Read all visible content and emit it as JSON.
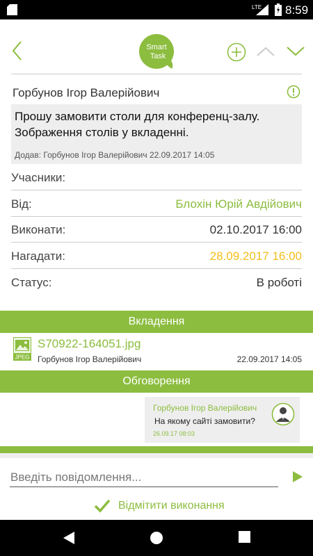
{
  "status_bar": {
    "network": "LTE",
    "time": "8:59"
  },
  "header": {
    "logo_line1": "Smart",
    "logo_line2": "Task"
  },
  "task": {
    "author": "Горбунов Ігор Валерійович",
    "message": "Прошу замовити столи для конференц-залу. Зображення столів у вкладенні.",
    "added_by_label": "Додав:",
    "added_by_name": "Горбунов Ігор Валерійович",
    "added_at": "22.09.2017 14:05"
  },
  "fields": {
    "participants_label": "Учасники:",
    "participants_value": "",
    "from_label": "Від:",
    "from_value": "Блохін Юрій Авдійович",
    "due_label": "Виконати:",
    "due_value": "02.10.2017 16:00",
    "remind_label": "Нагадати:",
    "remind_value": "28.09.2017 16:00",
    "status_label": "Статус:",
    "status_value": "В роботі"
  },
  "attachments": {
    "title": "Вкладення",
    "items": [
      {
        "file_type": "JPEG",
        "filename": "S70922-164051.jpg",
        "uploader": "Горбунов Ігор Валерійович",
        "date": "22.09.2017 14:05"
      }
    ]
  },
  "discussion": {
    "title": "Обговорення",
    "comments": [
      {
        "author": "Горбунов Ігор Валерійович",
        "text": "На якому сайті замовити?",
        "time": "26.09.17 08:03"
      }
    ]
  },
  "composer": {
    "placeholder": "Введіть повідомлення...",
    "value": ""
  },
  "complete_action": {
    "label": "Відмітити виконання"
  },
  "colors": {
    "accent": "#8cbd3f",
    "reminder": "#f2be1a",
    "panel": "#eeeeee"
  },
  "icons": {
    "back": "chevron-left-icon",
    "add": "plus-circle-icon",
    "prev": "chevron-up-icon",
    "next": "chevron-down-icon",
    "alert": "exclamation-circle-icon",
    "attachment": "jpeg-file-icon",
    "avatar": "user-avatar-icon",
    "send": "send-icon",
    "complete": "check-icon"
  }
}
